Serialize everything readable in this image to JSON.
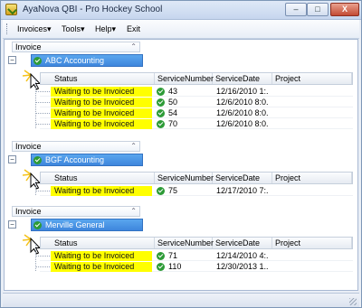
{
  "window": {
    "title": "AyaNova QBI - Pro Hockey School",
    "minimize": "–",
    "maximize": "□",
    "close": "X"
  },
  "menu": [
    "Invoices▾",
    "Tools▾",
    "Help▾",
    "Exit"
  ],
  "columns": {
    "status": "Status",
    "service_number": "ServiceNumber",
    "service_date": "ServiceDate",
    "project": "Project"
  },
  "groups": [
    {
      "header": "Invoice",
      "company": "ABC Accounting",
      "rows": [
        {
          "status": "Waiting to be Invoiced",
          "number": "43",
          "date": "12/16/2010 1:..."
        },
        {
          "status": "Waiting to be Invoiced",
          "number": "50",
          "date": "12/6/2010 8:0..."
        },
        {
          "status": "Waiting to be Invoiced",
          "number": "54",
          "date": "12/6/2010 8:0..."
        },
        {
          "status": "Waiting to be Invoiced",
          "number": "70",
          "date": "12/6/2010 8:0..."
        }
      ]
    },
    {
      "header": "Invoice",
      "company": "BGF Accounting",
      "rows": [
        {
          "status": "Waiting to be Invoiced",
          "number": "75",
          "date": "12/17/2010 7:..."
        }
      ]
    },
    {
      "header": "Invoice",
      "company": "Merville General",
      "rows": [
        {
          "status": "Waiting to be Invoiced",
          "number": "71",
          "date": "12/14/2010 4:..."
        },
        {
          "status": "Waiting to be Invoiced",
          "number": "110",
          "date": "12/30/2013 1..."
        }
      ]
    }
  ],
  "colors": {
    "selection": "#4a93e6",
    "status_highlight": "#ffff00",
    "check_green": "#2d9b37"
  },
  "icons": {
    "app": "app-logo-icon",
    "check": "check-circle-icon",
    "cursor": "mouse-pointer-icon"
  }
}
